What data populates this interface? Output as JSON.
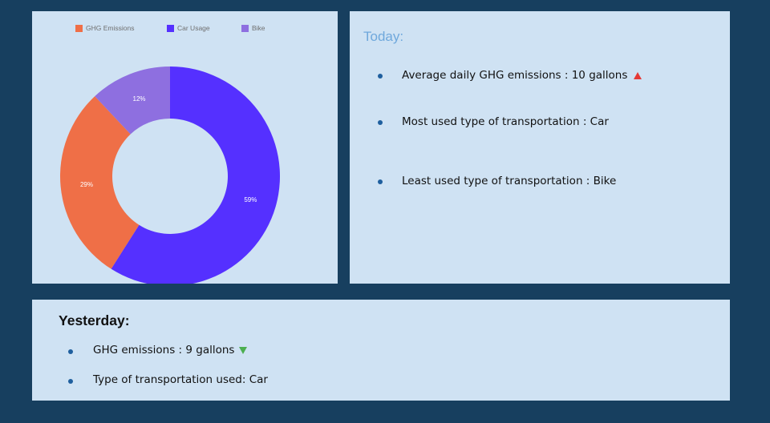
{
  "chart_data": {
    "type": "pie",
    "donut": true,
    "legend_position": "top",
    "title": "",
    "categories": [
      "GHG Emissions",
      "Car Usage",
      "Bike"
    ],
    "values": [
      29,
      59,
      12
    ],
    "labels": [
      "29%",
      "59%",
      "12%"
    ],
    "colors": [
      "#ef6f47",
      "#5530ff",
      "#8e6fe0"
    ],
    "start_angle_deg": 0,
    "order": [
      "Car Usage",
      "GHG Emissions",
      "Bike"
    ]
  },
  "today": {
    "title": "Today:",
    "items": [
      {
        "text": "Average daily GHG emissions : 10 gallons",
        "trend": "up"
      },
      {
        "text": "Most used type of transportation : Car"
      },
      {
        "text": "Least used type of transportation : Bike"
      }
    ],
    "trend_colors": {
      "up": "#e53935",
      "down": "#4caf50"
    }
  },
  "yesterday": {
    "title": "Yesterday:",
    "items": [
      {
        "text": "GHG emissions : 9 gallons",
        "trend": "down"
      },
      {
        "text": "Type of transportation used: Car"
      }
    ]
  }
}
